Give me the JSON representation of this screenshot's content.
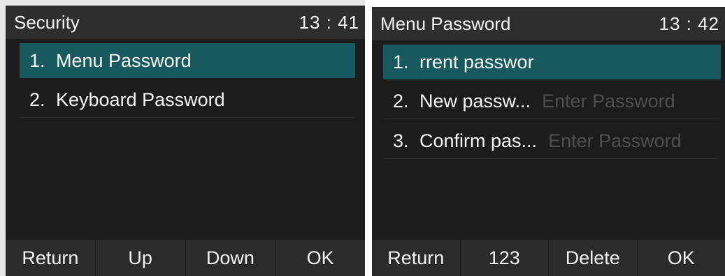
{
  "left": {
    "title": "Security",
    "time": "13 : 41",
    "items": [
      {
        "num": "1.",
        "label": "Menu Password"
      },
      {
        "num": "2.",
        "label": "Keyboard Password"
      }
    ],
    "softkeys": [
      "Return",
      "Up",
      "Down",
      "OK"
    ]
  },
  "right": {
    "title": "Menu Password",
    "time": "13 : 42",
    "items": [
      {
        "num": "1.",
        "label": "rrent passwor",
        "placeholder": ""
      },
      {
        "num": "2.",
        "label": "New passw...",
        "placeholder": "Enter Password"
      },
      {
        "num": "3.",
        "label": "Confirm pas...",
        "placeholder": "Enter Password"
      }
    ],
    "softkeys": [
      "Return",
      "123",
      "Delete",
      "OK"
    ]
  },
  "colors": {
    "background": "#1c1c1c",
    "titlebar": "#2e2e2e",
    "selected": "#17595d",
    "softkey_bar": "#2b2b2b",
    "placeholder": "#4f4f4f"
  }
}
